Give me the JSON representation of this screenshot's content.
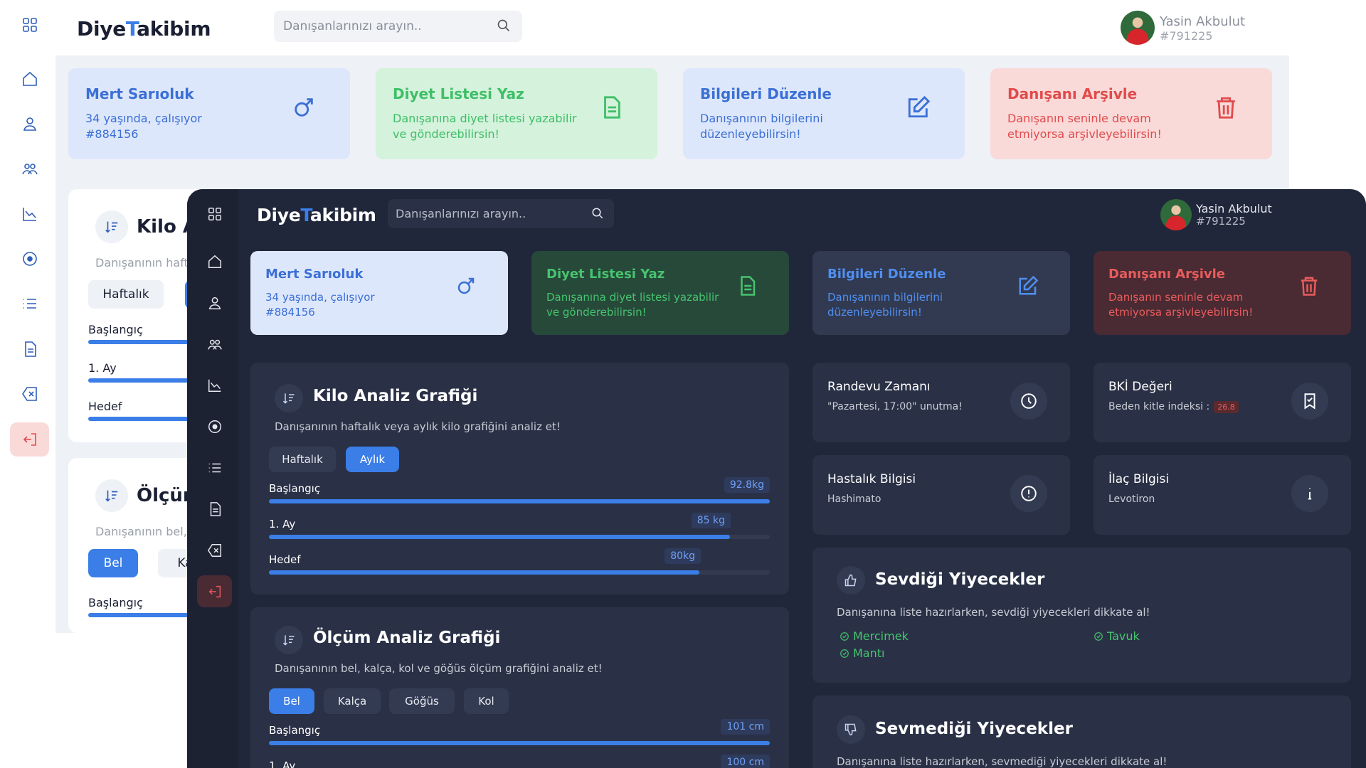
{
  "brand": {
    "prefix": "Diye",
    "middle": "T",
    "suffix": "akibim"
  },
  "search": {
    "placeholder": "Danışanlarınızı arayın.."
  },
  "user": {
    "name": "Yasin Akbulut",
    "id": "#791225"
  },
  "sidebar": {
    "items": [
      "dashboard",
      "home",
      "user",
      "users",
      "chart",
      "target",
      "list",
      "document",
      "close",
      "logout"
    ]
  },
  "cards": [
    {
      "title": "Mert Sarıoluk",
      "line1": "34 yaşında, çalışıyor",
      "line2": "#884156",
      "icon": "male-icon"
    },
    {
      "title": "Diyet Listesi Yaz",
      "line1": "Danışanına diyet listesi yazabilir ve gönderebilirsin!",
      "icon": "document-icon"
    },
    {
      "title": "Bilgileri Düzenle",
      "line1": "Danışanının bilgilerini düzenleyebilirsin!",
      "icon": "edit-icon"
    },
    {
      "title": "Danışanı Arşivle",
      "line1": "Danışanın seninle devam etmiyorsa arşivleyebilirsin!",
      "icon": "trash-icon"
    }
  ],
  "colors": {
    "accent": "#3b7ee8",
    "green": "#46c46e",
    "red": "#e14b4b"
  },
  "weight": {
    "title": "Kilo Analiz Grafiği",
    "light_title": "Kilo A",
    "subtitle": "Danışanının haftalık veya aylık kilo grafiğini analiz et!",
    "light_subtitle": "Danışanının haft",
    "tabs": [
      "Haftalık",
      "Aylık"
    ],
    "active_tab": "Aylık",
    "rows": [
      {
        "label": "Başlangıç",
        "value": "92.8kg",
        "fill": 1.0
      },
      {
        "label": "1. Ay",
        "value": "85 kg",
        "fill": 0.92
      },
      {
        "label": "Hedef",
        "value": "80kg",
        "fill": 0.86
      }
    ]
  },
  "measure": {
    "title": "Ölçüm Analiz Grafiği",
    "light_title": "Ölçün",
    "subtitle": "Danışanının bel, kalça, kol ve göğüs ölçüm grafiğini analiz et!",
    "light_subtitle": "Danışanının bel,",
    "tabs": [
      "Bel",
      "Kalça",
      "Göğüs",
      "Kol"
    ],
    "light_tabs": [
      "Bel",
      "Kalç"
    ],
    "active_tab": "Bel",
    "rows": [
      {
        "label": "Başlangıç",
        "value": "101 cm",
        "fill": 1.0
      },
      {
        "label": "1. Ay",
        "value": "100 cm",
        "fill": 0.97
      }
    ]
  },
  "info": {
    "appointment": {
      "title": "Randevu Zamanı",
      "text": "\"Pazartesi, 17:00\" unutma!"
    },
    "bmi": {
      "title": "BKİ Değeri",
      "text": "Beden kitle indeksi :",
      "value": "26.8"
    },
    "disease": {
      "title": "Hastalık Bilgisi",
      "text": "Hashimato"
    },
    "medicine": {
      "title": "İlaç Bilgisi",
      "text": "Levotiron"
    }
  },
  "liked": {
    "title": "Sevdiği Yiyecekler",
    "subtitle": "Danışanına liste hazırlarken, sevdiği yiyecekleri dikkate al!",
    "items": [
      "Mercimek",
      "Tavuk",
      "Mantı"
    ]
  },
  "disliked": {
    "title": "Sevmediği Yiyecekler",
    "subtitle": "Danışanına liste hazırlarken, sevmediği yiyecekleri dikkate al!"
  }
}
